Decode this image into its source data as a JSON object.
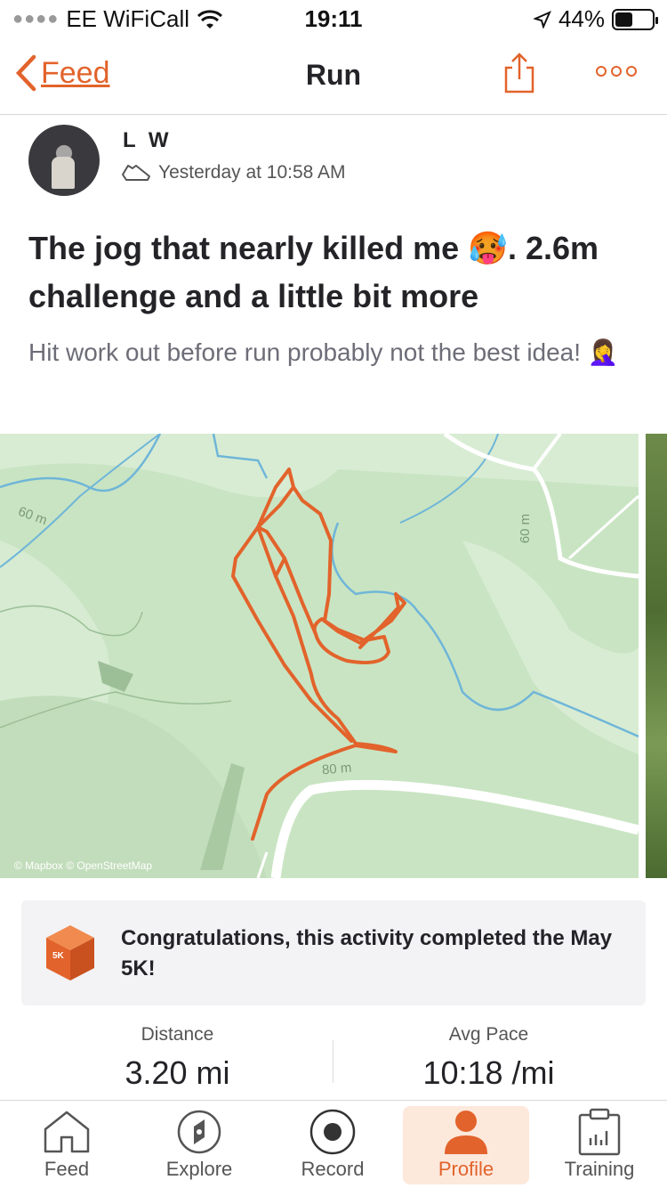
{
  "status": {
    "carrier": "EE WiFiCall",
    "time": "19:11",
    "battery": "44%",
    "battery_level": 0.44
  },
  "nav": {
    "back_label": "Feed",
    "title": "Run"
  },
  "activity": {
    "athlete": "L W",
    "timestamp": "Yesterday at 10:58 AM",
    "title": "The jog that nearly killed me 🥵. 2.6m challenge and a little bit more",
    "description": "Hit work out before run probably not the best idea! 🤦‍♀️"
  },
  "map": {
    "contour_labels": [
      "60 m",
      "60 m",
      "80 m"
    ],
    "attribution": "© Mapbox © OpenStreetMap",
    "route_color": "#e2632b"
  },
  "achievement": {
    "badge_label": "5K",
    "text": "Congratulations, this activity completed the May 5K!"
  },
  "stats": [
    {
      "label": "Distance",
      "value": "3.20 mi"
    },
    {
      "label": "Avg Pace",
      "value": "10:18 /mi"
    }
  ],
  "tabs": [
    {
      "label": "Feed",
      "icon": "home-icon"
    },
    {
      "label": "Explore",
      "icon": "compass-icon"
    },
    {
      "label": "Record",
      "icon": "record-icon"
    },
    {
      "label": "Profile",
      "icon": "profile-icon",
      "active": true
    },
    {
      "label": "Training",
      "icon": "calendar-chart-icon"
    }
  ],
  "colors": {
    "accent": "#e2632b",
    "map_bg": "#c9e4c3",
    "text": "#242428"
  }
}
